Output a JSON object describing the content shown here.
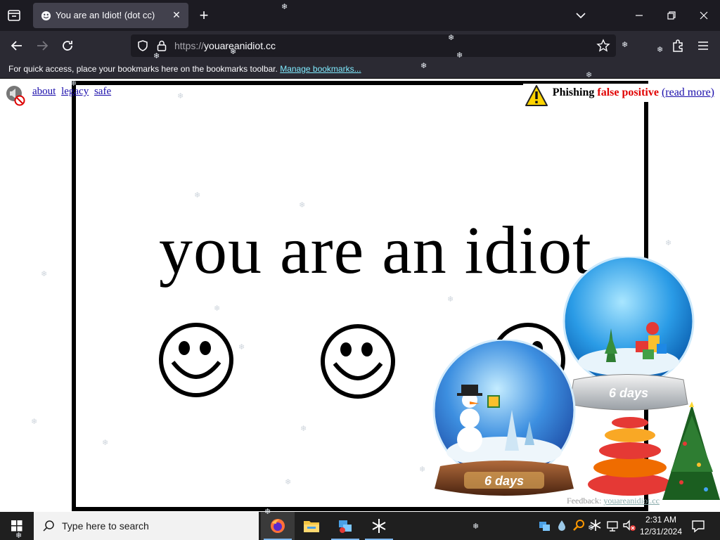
{
  "tab": {
    "title": "You are an Idiot! (dot cc)",
    "close": "✕"
  },
  "new_tab": "+",
  "url": {
    "protocol": "https://",
    "host": "youareanidiot.cc"
  },
  "bookmarks_bar": {
    "message": "For quick access, place your bookmarks here on the bookmarks toolbar.",
    "link": "Manage bookmarks..."
  },
  "page": {
    "links": [
      "about",
      "legacy",
      "safe"
    ],
    "notice": {
      "prefix": "Phishing",
      "highlight": "false positive",
      "link": "(read more)"
    },
    "headline": "you are an idiot",
    "feedback": {
      "prefix": "Feedback:",
      "link": "youareanidiot.cc"
    },
    "globes": [
      {
        "label": "6 days"
      },
      {
        "label": "6 days"
      }
    ]
  },
  "taskbar": {
    "search_placeholder": "Type here to search",
    "time": "2:31 AM",
    "date": "12/31/2024"
  },
  "colors": {
    "chrome_dark": "#1c1b22",
    "toolbar": "#2b2a33",
    "tab_active": "#42414d",
    "link_blue": "#1a0dab",
    "warning_red": "#e00000",
    "taskbar": "#1f1f1f"
  },
  "icons": [
    "tab-list-icon",
    "smiley-favicon-icon",
    "close-icon",
    "plus-icon",
    "chevron-down-icon",
    "minimize-icon",
    "maximize-icon",
    "close-window-icon",
    "back-arrow-icon",
    "forward-arrow-icon",
    "reload-icon",
    "shield-icon",
    "lock-icon",
    "star-icon",
    "extensions-icon",
    "menu-icon",
    "speaker-mute-icon",
    "warning-icon",
    "smiley-icon",
    "snow-globe-icon",
    "christmas-tree-icon",
    "windows-start-icon",
    "search-icon",
    "firefox-icon",
    "file-explorer-icon",
    "network-icon",
    "volume-mute-icon",
    "notification-icon"
  ]
}
